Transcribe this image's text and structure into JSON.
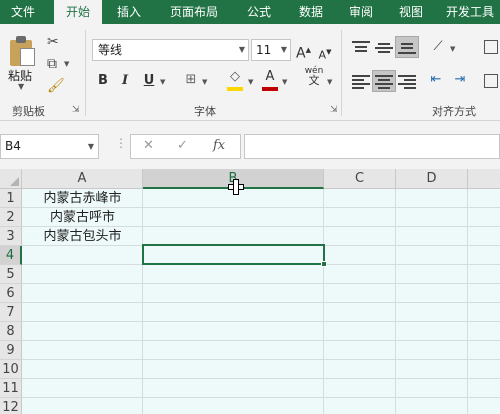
{
  "tabs": [
    {
      "label": "文件",
      "active": false
    },
    {
      "label": "开始",
      "active": true
    },
    {
      "label": "插入",
      "active": false
    },
    {
      "label": "页面布局",
      "active": false
    },
    {
      "label": "公式",
      "active": false
    },
    {
      "label": "数据",
      "active": false
    },
    {
      "label": "审阅",
      "active": false
    },
    {
      "label": "视图",
      "active": false
    },
    {
      "label": "开发工具",
      "active": false
    }
  ],
  "ribbon": {
    "clipboard": {
      "paste_label": "粘贴",
      "group_label": "剪贴板"
    },
    "font": {
      "font_name": "等线",
      "font_size": "11",
      "grow_label": "A",
      "shrink_label": "A",
      "bold_label": "B",
      "italic_label": "I",
      "underline_label": "U",
      "font_color_label": "A",
      "phonetic_label": "wén",
      "group_label": "字体"
    },
    "alignment": {
      "group_label": "对齐方式"
    }
  },
  "formula_bar": {
    "name_box": "B4",
    "cancel_glyph": "✕",
    "enter_glyph": "✓",
    "fx_label": "fx",
    "formula_value": ""
  },
  "grid": {
    "columns": [
      "A",
      "B",
      "C",
      "D"
    ],
    "selected_column": "B",
    "rows": [
      "1",
      "2",
      "3",
      "4",
      "5",
      "6",
      "7",
      "8",
      "9",
      "10",
      "11",
      "12"
    ],
    "selected_row": "4",
    "active_cell": "B4",
    "cells": {
      "A1": "内蒙古赤峰市",
      "A2": "内蒙古呼市",
      "A3": "内蒙古包头市"
    }
  },
  "colors": {
    "accent": "#217346",
    "sheet_background": "#eef9f9",
    "ribbon_background": "#f3f3f3"
  }
}
